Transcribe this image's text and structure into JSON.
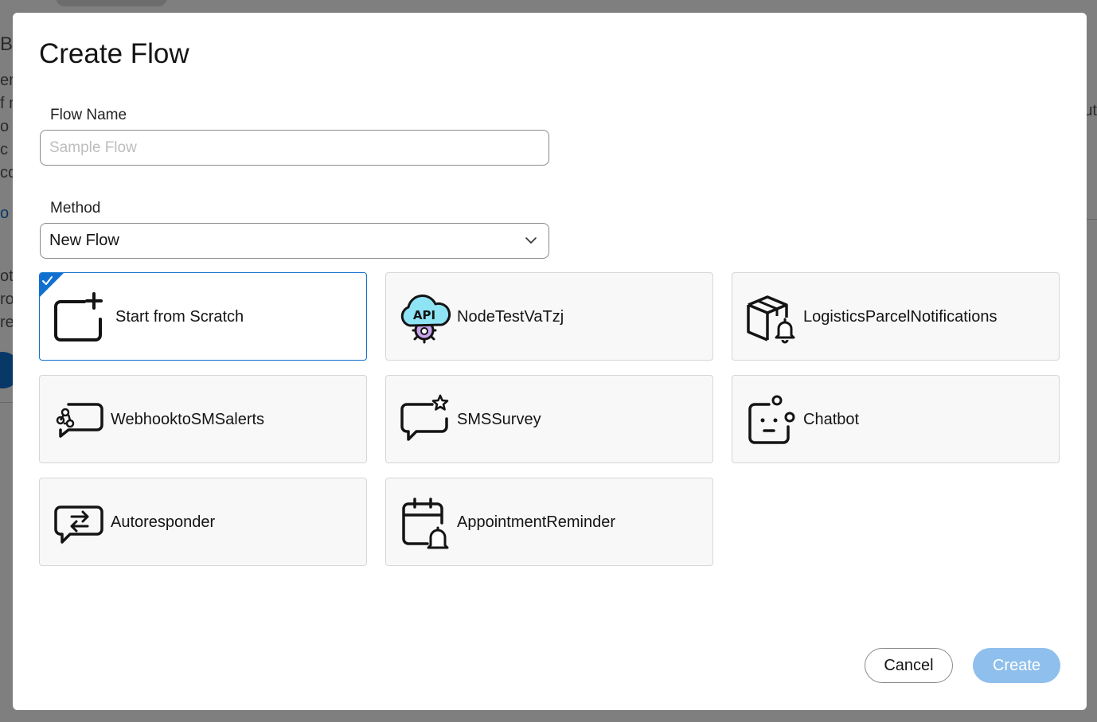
{
  "background": {
    "left_fragments": [
      "Bu",
      "er",
      "f n",
      "o",
      "c",
      "cc",
      "o",
      "ot",
      "ro",
      "re"
    ],
    "right_fragment": "ut"
  },
  "modal": {
    "title": "Create Flow",
    "flow_name": {
      "label": "Flow Name",
      "value": "",
      "placeholder": "Sample Flow"
    },
    "method": {
      "label": "Method",
      "selected": "New Flow",
      "icon": "chevron-down-icon"
    },
    "templates": [
      {
        "label": "Start from Scratch",
        "icon": "add-canvas-icon",
        "selected": true
      },
      {
        "label": "NodeTestVaTzj",
        "icon": "api-cloud-icon",
        "selected": false
      },
      {
        "label": "LogisticsParcelNotifications",
        "icon": "parcel-bell-icon",
        "selected": false
      },
      {
        "label": "WebhooktoSMSalerts",
        "icon": "webhook-message-icon",
        "selected": false
      },
      {
        "label": "SMSSurvey",
        "icon": "message-star-icon",
        "selected": false
      },
      {
        "label": "Chatbot",
        "icon": "bot-icon",
        "selected": false
      },
      {
        "label": "Autoresponder",
        "icon": "message-arrows-icon",
        "selected": false
      },
      {
        "label": "AppointmentReminder",
        "icon": "calendar-bell-icon",
        "selected": false
      }
    ],
    "buttons": {
      "cancel": "Cancel",
      "create": "Create"
    },
    "colors": {
      "accent": "#1170cf",
      "create_disabled": "#8fbfec",
      "api_cloud_fill": "#8ee3f5",
      "api_gear_fill": "#c9a4ee"
    }
  }
}
